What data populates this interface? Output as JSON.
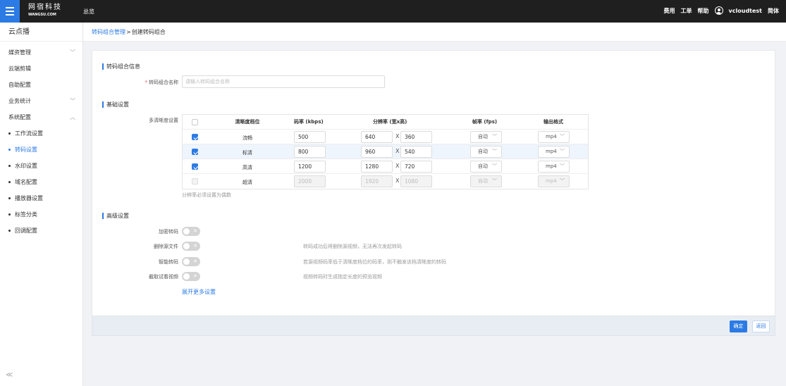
{
  "topbar": {
    "logo_cn": "网宿科技",
    "logo_en": "WANGSU.COM",
    "home": "总览",
    "links": [
      "费用",
      "工单",
      "帮助"
    ],
    "user": "vcloudtest",
    "lang": "简体"
  },
  "sidebar": {
    "title": "云点播",
    "items": [
      {
        "label": "媒资管理",
        "chevron": "﹀"
      },
      {
        "label": "云端剪辑"
      },
      {
        "label": "自助配置"
      },
      {
        "label": "业务统计",
        "chevron": "﹀"
      },
      {
        "label": "系统配置",
        "chevron": "︿"
      }
    ],
    "subitems": [
      {
        "label": "工作流设置"
      },
      {
        "label": "转码设置"
      },
      {
        "label": "水印设置"
      },
      {
        "label": "域名配置"
      },
      {
        "label": "播放器设置"
      },
      {
        "label": "标签分类"
      },
      {
        "label": "回调配置"
      }
    ],
    "collapse": "≪"
  },
  "breadcrumb": {
    "parent": "转码组合管理",
    "sep": ">",
    "current": "创建转码组合"
  },
  "info": {
    "section": "转码组合信息",
    "name_required": "*",
    "name_label": "转码组合名称",
    "name_placeholder": "请输入转码组合名称"
  },
  "basic": {
    "section": "基础设置",
    "multi_label": "多清晰度设置",
    "headers": {
      "level": "清晰度档位",
      "bitrate": "码率 (kbps)",
      "resolution": "分辨率 (宽x高)",
      "fps": "帧率 (fps)",
      "format": "输出格式"
    },
    "rows": [
      {
        "level": "流畅",
        "bitrate": "500",
        "width": "640",
        "height": "360",
        "fps": "自动",
        "format": "mp4",
        "checked": true
      },
      {
        "level": "标清",
        "bitrate": "800",
        "width": "960",
        "height": "540",
        "fps": "自动",
        "format": "mp4",
        "checked": true
      },
      {
        "level": "高清",
        "bitrate": "1200",
        "width": "1280",
        "height": "720",
        "fps": "自动",
        "format": "mp4",
        "checked": true
      },
      {
        "level": "超清",
        "bitrate": "2000",
        "width": "1920",
        "height": "1080",
        "fps": "自动",
        "format": "mp4",
        "checked": false
      }
    ],
    "x_sep": "X",
    "chevron": "﹀",
    "hint": "分辨率必须设置为偶数"
  },
  "advanced": {
    "section": "高级设置",
    "toggle_off_mark": "✕",
    "options": [
      {
        "label": "加密转码",
        "desc": ""
      },
      {
        "label": "删除源文件",
        "desc": "转码成功后将删除源视频，无法再次发起转码"
      },
      {
        "label": "智能转码",
        "desc": "若源视频码率低于清晰度档位的码率，则不触发该档清晰度的转码"
      },
      {
        "label": "截取试看视频",
        "desc": "视频转码时生成指定长度的预览视频"
      }
    ],
    "more": "展开更多设置"
  },
  "footer": {
    "ok": "确定",
    "back": "返回"
  },
  "colors": {
    "accent": "#2c7be5",
    "topbar": "#1f1f1f",
    "row_highlight": "#eef5fd"
  }
}
